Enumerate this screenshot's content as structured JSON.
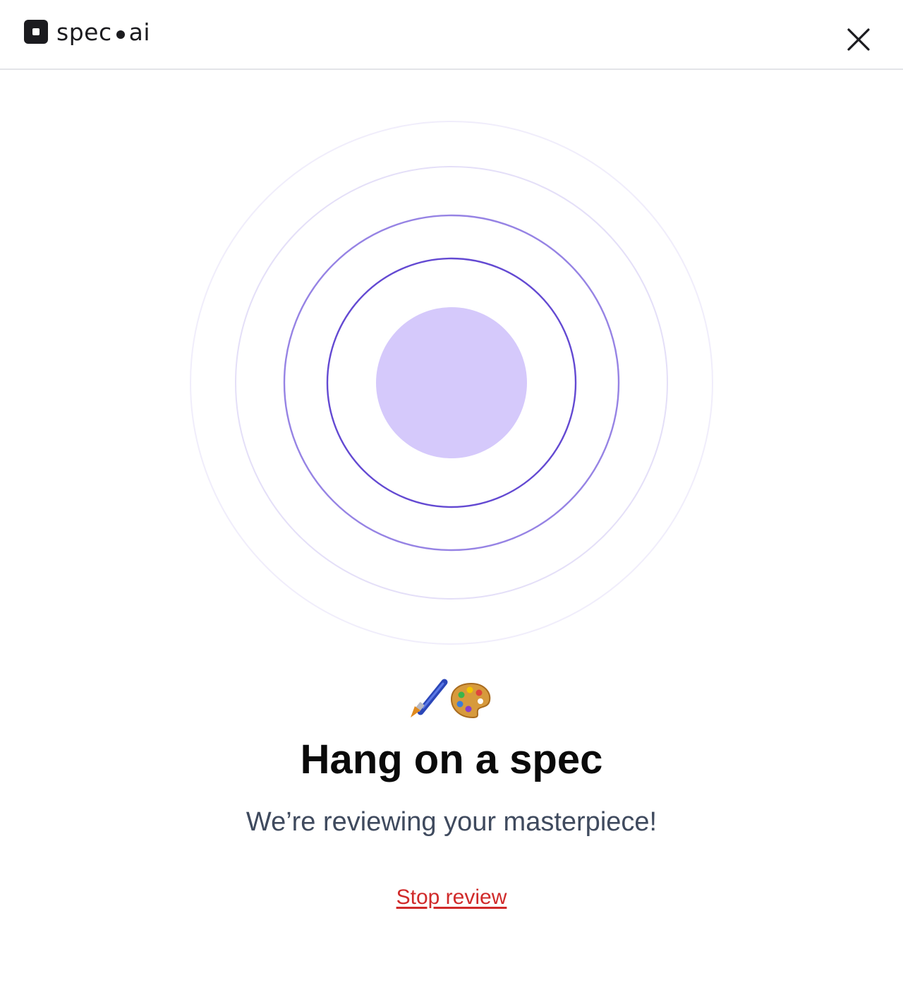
{
  "header": {
    "logo_text_left": "spec",
    "logo_text_right": "ai",
    "close_icon": "close-icon"
  },
  "loader": {
    "ring_color": "#6a4fd8",
    "core_color": "#d5c9fb"
  },
  "emoji": {
    "brush_icon": "paintbrush-icon",
    "palette_icon": "palette-icon"
  },
  "main": {
    "title": "Hang on a spec",
    "subtitle": "We’re reviewing your masterpiece!",
    "stop_label": "Stop review",
    "stop_color": "#d02a2a"
  }
}
